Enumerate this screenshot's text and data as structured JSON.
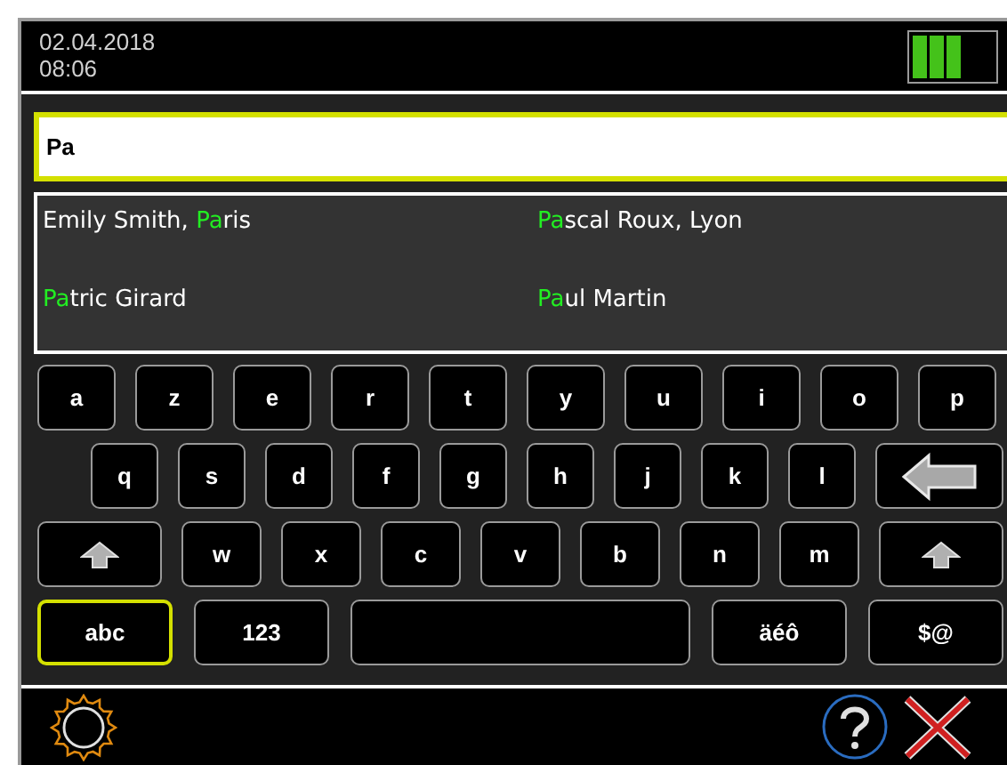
{
  "status_bar": {
    "date": "02.04.2018",
    "time": "08:06"
  },
  "search": {
    "value": "Pa",
    "focused": true
  },
  "results": [
    {
      "parts": [
        {
          "text": "Emily Smith, ",
          "highlighted": false
        },
        {
          "text": "Pa",
          "highlighted": true
        },
        {
          "text": "ris",
          "highlighted": false
        }
      ]
    },
    {
      "parts": [
        {
          "text": "Pa",
          "highlighted": true
        },
        {
          "text": "scal Roux, Lyon",
          "highlighted": false
        }
      ]
    },
    {
      "parts": [
        {
          "text": "Pa",
          "highlighted": true
        },
        {
          "text": "tric Girard",
          "highlighted": false
        }
      ]
    },
    {
      "parts": [
        {
          "text": "Pa",
          "highlighted": true
        },
        {
          "text": "ul Martin",
          "highlighted": false
        }
      ]
    }
  ],
  "keyboard": {
    "rows": [
      [
        {
          "kind": "char",
          "label": "a"
        },
        {
          "kind": "char",
          "label": "z"
        },
        {
          "kind": "char",
          "label": "e"
        },
        {
          "kind": "char",
          "label": "r"
        },
        {
          "kind": "char",
          "label": "t"
        },
        {
          "kind": "char",
          "label": "y"
        },
        {
          "kind": "char",
          "label": "u"
        },
        {
          "kind": "char",
          "label": "i"
        },
        {
          "kind": "char",
          "label": "o"
        },
        {
          "kind": "char",
          "label": "p"
        }
      ],
      [
        {
          "kind": "char",
          "label": "q"
        },
        {
          "kind": "char",
          "label": "s"
        },
        {
          "kind": "char",
          "label": "d"
        },
        {
          "kind": "char",
          "label": "f"
        },
        {
          "kind": "char",
          "label": "g"
        },
        {
          "kind": "char",
          "label": "h"
        },
        {
          "kind": "char",
          "label": "j"
        },
        {
          "kind": "char",
          "label": "k"
        },
        {
          "kind": "char",
          "label": "l"
        },
        {
          "kind": "backspace"
        }
      ],
      [
        {
          "kind": "shift"
        },
        {
          "kind": "char",
          "label": "w"
        },
        {
          "kind": "char",
          "label": "x"
        },
        {
          "kind": "char",
          "label": "c"
        },
        {
          "kind": "char",
          "label": "v"
        },
        {
          "kind": "char",
          "label": "b"
        },
        {
          "kind": "char",
          "label": "n"
        },
        {
          "kind": "char",
          "label": "m"
        },
        {
          "kind": "shift"
        }
      ],
      [
        {
          "kind": "mode",
          "label": "abc",
          "selected": true
        },
        {
          "kind": "mode",
          "label": "123",
          "selected": false
        },
        {
          "kind": "space"
        },
        {
          "kind": "mode",
          "label": "äéô",
          "selected": false
        },
        {
          "kind": "mode",
          "label": "$@",
          "selected": false
        }
      ]
    ]
  }
}
